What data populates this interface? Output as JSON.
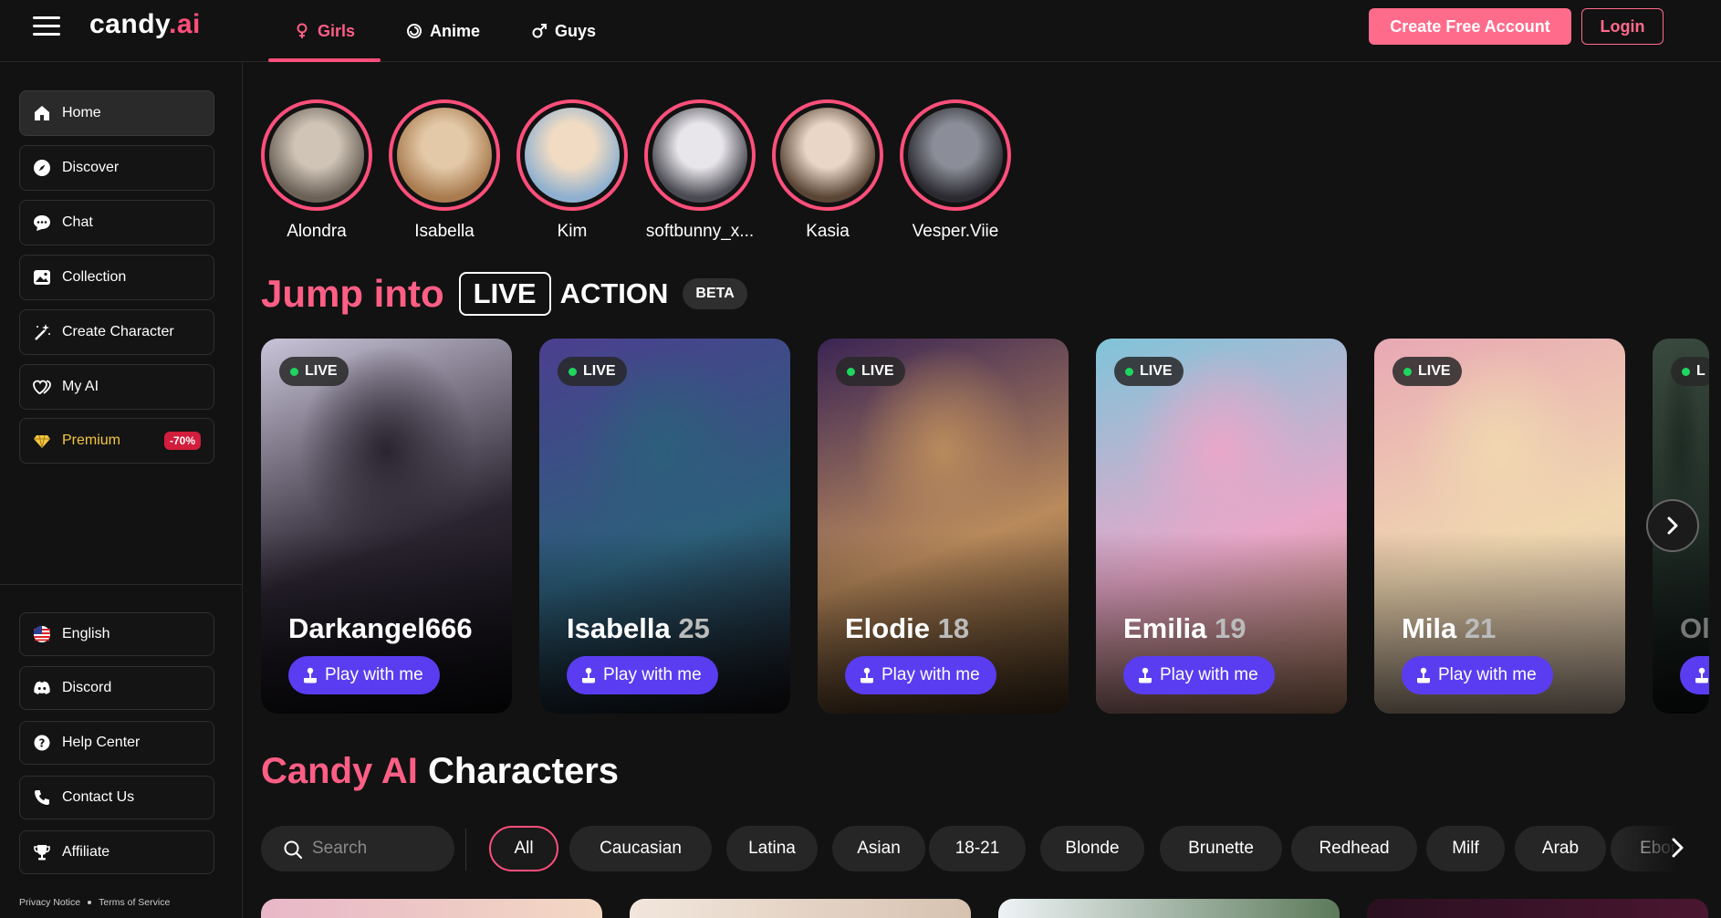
{
  "header": {
    "logo_main": "candy",
    "logo_accent": ".ai",
    "tabs": [
      {
        "label": "Girls",
        "icon": "female-icon",
        "active": true
      },
      {
        "label": "Anime",
        "icon": "anime-swirl-icon",
        "active": false
      },
      {
        "label": "Guys",
        "icon": "male-icon",
        "active": false
      }
    ],
    "create_account_label": "Create Free Account",
    "login_label": "Login"
  },
  "sidebar": {
    "items": [
      {
        "label": "Home",
        "icon": "home-icon",
        "active": true
      },
      {
        "label": "Discover",
        "icon": "compass-icon"
      },
      {
        "label": "Chat",
        "icon": "chat-bubble-icon"
      },
      {
        "label": "Collection",
        "icon": "image-icon"
      },
      {
        "label": "Create Character",
        "icon": "magic-wand-icon"
      },
      {
        "label": "My AI",
        "icon": "hearts-icon"
      },
      {
        "label": "Premium",
        "icon": "diamond-icon",
        "badge": "-70%"
      }
    ],
    "bottom_items": [
      {
        "label": "English",
        "icon": "us-flag-icon"
      },
      {
        "label": "Discord",
        "icon": "discord-icon"
      },
      {
        "label": "Help Center",
        "icon": "help-icon"
      },
      {
        "label": "Contact Us",
        "icon": "phone-icon"
      },
      {
        "label": "Affiliate",
        "icon": "trophy-icon"
      }
    ],
    "privacy_label": "Privacy Notice",
    "terms_label": "Terms of Service"
  },
  "stories": [
    {
      "name": "Alondra",
      "colors": [
        "#6b6157",
        "#cfc4b6"
      ]
    },
    {
      "name": "Isabella",
      "colors": [
        "#a97b4f",
        "#e3c9a8"
      ]
    },
    {
      "name": "Kim",
      "colors": [
        "#8fb0cf",
        "#f1dcc3"
      ]
    },
    {
      "name": "softbunny_x...",
      "colors": [
        "#4a4a52",
        "#e8e6ea"
      ]
    },
    {
      "name": "Kasia",
      "colors": [
        "#5b4636",
        "#e9d6c6"
      ]
    },
    {
      "name": "Vesper.Viie",
      "colors": [
        "#2b2a30",
        "#8b8e98"
      ]
    }
  ],
  "jump": {
    "title": "Jump into",
    "live": "LIVE",
    "action": "ACTION",
    "beta": "BETA"
  },
  "live_cards": [
    {
      "name": "Darkangel666",
      "age": "",
      "live": "LIVE",
      "play": "Play with me",
      "colors": [
        "#c9c4d8",
        "#2a2430",
        "#0d0b10"
      ]
    },
    {
      "name": "Isabella",
      "age": "25",
      "live": "LIVE",
      "play": "Play with me",
      "colors": [
        "#4b3f8f",
        "#2c5f7a",
        "#171217"
      ]
    },
    {
      "name": "Elodie",
      "age": "18",
      "live": "LIVE",
      "play": "Play with me",
      "colors": [
        "#3a2454",
        "#b98a5c",
        "#4a3520"
      ]
    },
    {
      "name": "Emilia",
      "age": "19",
      "live": "LIVE",
      "play": "Play with me",
      "colors": [
        "#7fc4d9",
        "#e9a7c9",
        "#c48f6c"
      ]
    },
    {
      "name": "Mila",
      "age": "21",
      "live": "LIVE",
      "play": "Play with me",
      "colors": [
        "#e8a8b4",
        "#f0d7b0",
        "#d9c3b0"
      ]
    },
    {
      "name": "Ol",
      "age": "",
      "live": "L",
      "play": "Play with me",
      "colors": [
        "#3a4a3e",
        "#1e2a24",
        "#101514"
      ]
    }
  ],
  "characters": {
    "title_accent": "Candy AI",
    "title_rest": "Characters",
    "search_placeholder": "Search",
    "filters": [
      "All",
      "Caucasian",
      "Latina",
      "Asian",
      "18-21",
      "Blonde",
      "Brunette",
      "Redhead",
      "Milf",
      "Arab",
      "Ebony"
    ]
  }
}
